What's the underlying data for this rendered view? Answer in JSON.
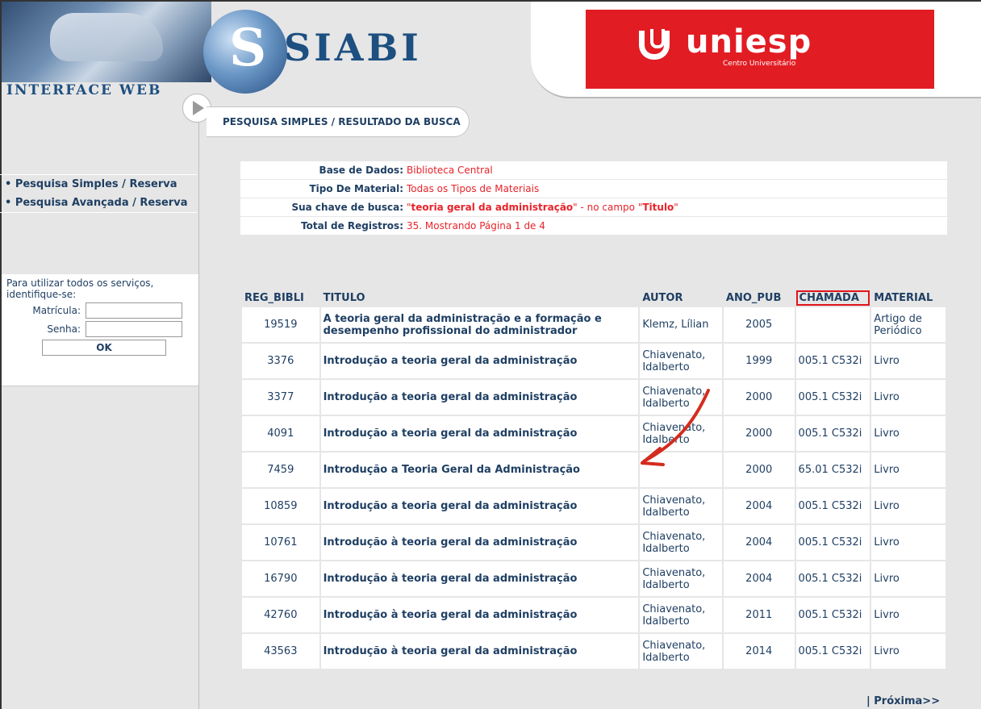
{
  "header": {
    "app_name": "SIABI",
    "interface_label": "INTERFACE WEB",
    "brand_name": "uniesp",
    "brand_subtitle": "Centro Universitário",
    "brand_color": "#e11d23"
  },
  "breadcrumb": "PESQUISA SIMPLES / RESULTADO DA BUSCA",
  "sidebar": {
    "menu": [
      {
        "label": "• Pesquisa Simples / Reserva"
      },
      {
        "label": "• Pesquisa Avançada / Reserva"
      }
    ],
    "login": {
      "info": "Para utilizar todos os serviços, identifique-se:",
      "matricula_label": "Matrícula:",
      "senha_label": "Senha:",
      "ok_label": "OK"
    }
  },
  "search_info": {
    "base_label": "Base de Dados:",
    "base_value": "Biblioteca Central",
    "tipo_label": "Tipo De Material:",
    "tipo_value": "Todas os Tipos de Materiais",
    "chave_label": "Sua chave de busca:",
    "chave_q1": "\"",
    "chave_term": "teoria geral da administração",
    "chave_mid": "\" - no campo \"",
    "chave_field": "Titulo",
    "chave_q2": "\"",
    "total_label": "Total de Registros:",
    "total_value": "35. Mostrando Página 1 de 4"
  },
  "results": {
    "columns": [
      "REG_BIBLI",
      "TITULO",
      "AUTOR",
      "ANO_PUB",
      "CHAMADA",
      "MATERIAL"
    ],
    "highlight_column": "CHAMADA",
    "rows": [
      {
        "reg": "19519",
        "titulo": "A teoria geral da administração e a formação e desempenho profissional do administrador",
        "autor": "Klemz, Lílian",
        "ano": "2005",
        "chamada": "",
        "material": "Artigo de Periódico"
      },
      {
        "reg": "3376",
        "titulo": "Introdução a teoria geral da administração",
        "autor": "Chiavenato, Idalberto",
        "ano": "1999",
        "chamada": "005.1 C532i",
        "material": "Livro"
      },
      {
        "reg": "3377",
        "titulo": "Introdução a teoria geral da administração",
        "autor": "Chiavenato, Idalberto",
        "ano": "2000",
        "chamada": "005.1 C532i",
        "material": "Livro"
      },
      {
        "reg": "4091",
        "titulo": "Introdução a teoria geral da administração",
        "autor": "Chiavenato, Idalberto",
        "ano": "2000",
        "chamada": "005.1 C532i",
        "material": "Livro"
      },
      {
        "reg": "7459",
        "titulo": "Introdução a Teoria Geral da Administração",
        "autor": "",
        "ano": "2000",
        "chamada": "65.01 C532i",
        "material": "Livro"
      },
      {
        "reg": "10859",
        "titulo": "Introdução a teoria geral da administração",
        "autor": "Chiavenato, Idalberto",
        "ano": "2004",
        "chamada": "005.1 C532i",
        "material": "Livro"
      },
      {
        "reg": "10761",
        "titulo": "Introdução à teoria geral da administração",
        "autor": "Chiavenato, Idalberto",
        "ano": "2004",
        "chamada": "005.1 C532i",
        "material": "Livro"
      },
      {
        "reg": "16790",
        "titulo": "Introdução à teoria geral da administração",
        "autor": "Chiavenato, Idalberto",
        "ano": "2004",
        "chamada": "005.1 C532i",
        "material": "Livro"
      },
      {
        "reg": "42760",
        "titulo": "Introdução à teoria geral da administração",
        "autor": "Chiavenato, Idalberto",
        "ano": "2011",
        "chamada": "005.1 C532i",
        "material": "Livro"
      },
      {
        "reg": "43563",
        "titulo": "Introdução à teoria geral da administração",
        "autor": "Chiavenato, Idalberto",
        "ano": "2014",
        "chamada": "005.1 C532i",
        "material": "Livro"
      }
    ]
  },
  "pagination": {
    "next_label": "| Próxima>>"
  },
  "annotation": {
    "arrow_color": "#d42b1e"
  }
}
